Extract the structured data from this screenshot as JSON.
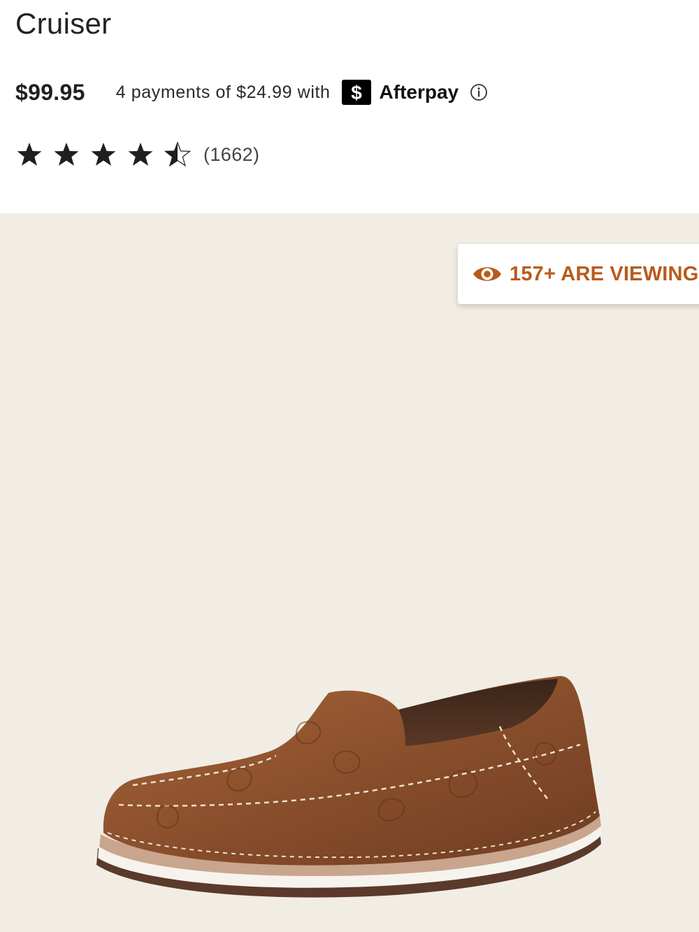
{
  "product": {
    "title": "Cruiser",
    "price": "$99.95"
  },
  "afterpay": {
    "installments_text": "4 payments of $24.99 with",
    "logo_glyph": "$",
    "brand": "Afterpay",
    "info_icon": "info-circle-icon"
  },
  "rating": {
    "value": 4.5,
    "max": 5,
    "count": "(1662)"
  },
  "badge": {
    "icon": "eye-icon",
    "text": "157+ ARE VIEWING"
  },
  "colors": {
    "badge_accent": "#b95a1c",
    "gallery_bg": "#f1ede5",
    "star": "#1f1f1f"
  }
}
